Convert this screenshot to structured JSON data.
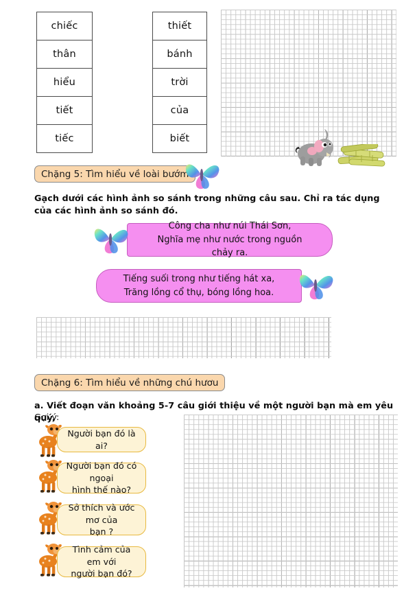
{
  "worksheet": {
    "left_word_column": [
      "chiếc",
      "thân",
      "hiểu",
      "tiết",
      "tiếc"
    ],
    "right_word_column": [
      "thiết",
      "bánh",
      "trời",
      "của",
      "biết"
    ]
  },
  "stage5": {
    "badge": "Chặng 5: Tìm hiểu về loài bướm",
    "instruction_line1": "Gạch dưới các hình ảnh so sánh trong những câu sau. Chỉ ra tác dụng",
    "instruction_line2": "của các hình ảnh so sánh đó.",
    "poems": [
      {
        "line1": "Công cha như núi Thái Sơn,",
        "line2": "Nghĩa mẹ như nước trong nguồn chảy ra."
      },
      {
        "line1": "Tiếng suối trong như tiếng hát xa,",
        "line2": "Trăng lồng cổ thụ, bóng lồng hoa."
      }
    ]
  },
  "stage6": {
    "badge": "Chặng 6: Tìm hiểu về những chú hươu",
    "task_a": "a. Viết đoạn văn khoảng 5-7 câu giới thiệu về một người bạn mà em yêu quý.",
    "hint_label": "Gợi ý:",
    "questions": [
      {
        "line1": "Người bạn đó là ai?",
        "line2": ""
      },
      {
        "line1": "Người bạn đó có ngoại",
        "line2": "hình thế nào?"
      },
      {
        "line1": "Sở thích và ước mơ của",
        "line2": "bạn ?"
      },
      {
        "line1": "Tình cảm của em với",
        "line2": "người bạn đó?"
      }
    ]
  },
  "icons": {
    "butterfly": "butterfly-icon",
    "elephant": "elephant-icon",
    "sugarcane": "sugarcane-icon",
    "deer": "deer-icon"
  },
  "colors": {
    "stage_badge_bg": "#fad7ad",
    "poem_bg": "#f58ff0",
    "question_bg": "#fdf3d6",
    "question_border": "#e8b93f",
    "grid_major": "#5a5a5a",
    "grid_minor": "#c9c9c9",
    "elephant_body": "#9a9a9a",
    "deer_body": "#e8821e",
    "sugarcane": "#c9cf63"
  }
}
